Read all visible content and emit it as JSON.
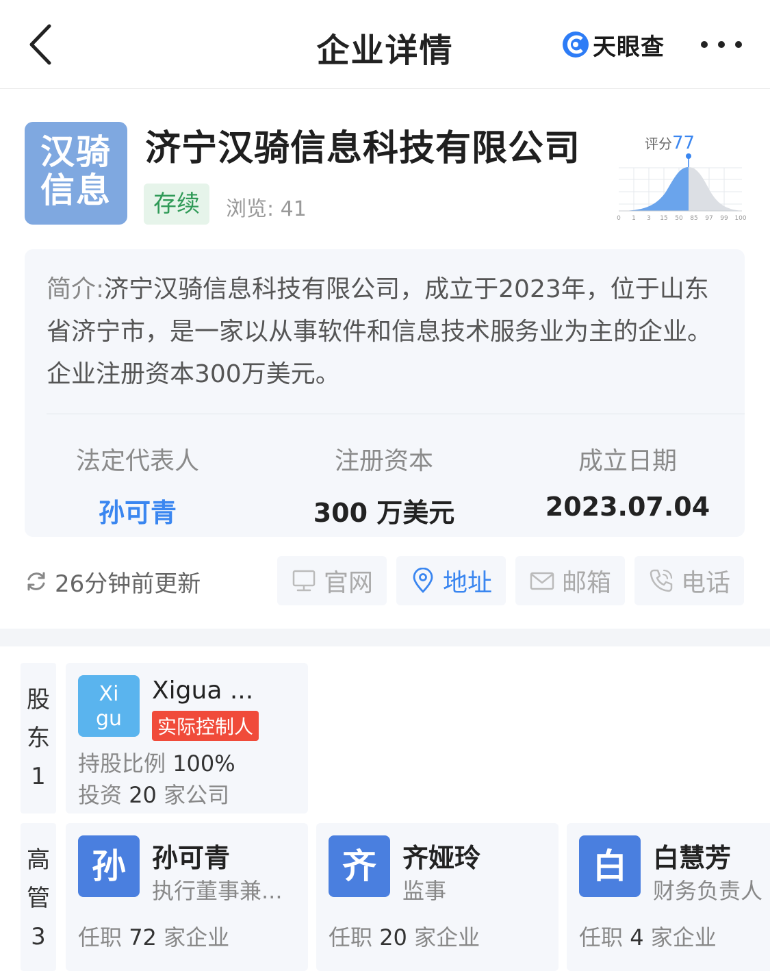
{
  "header": {
    "title": "企业详情",
    "brand": "天眼查"
  },
  "company": {
    "logo_line1": "汉骑",
    "logo_line2": "信息",
    "name": "济宁汉骑信息科技有限公司",
    "status": "存续",
    "views_label": "浏览: 41",
    "score_label": "评分",
    "score_value": "77",
    "score_axis_ticks": [
      "0",
      "1",
      "3",
      "15",
      "50",
      "85",
      "97",
      "99",
      "100"
    ]
  },
  "intro": {
    "key": "简介:",
    "text": "济宁汉骑信息科技有限公司，成立于2023年，位于山东省济宁市，是一家以从事软件和信息技术服务业为主的企业。企业注册资本300万美元。"
  },
  "stats": [
    {
      "label": "法定代表人",
      "value": "孙可青"
    },
    {
      "label": "注册资本",
      "value": "300 万美元"
    },
    {
      "label": "成立日期",
      "value": "2023.07.04"
    }
  ],
  "update_text": "26分钟前更新",
  "actions": [
    {
      "label": "官网",
      "icon": "monitor-icon",
      "active": false
    },
    {
      "label": "地址",
      "icon": "location-pin-icon",
      "active": true
    },
    {
      "label": "邮箱",
      "icon": "mail-icon",
      "active": false
    },
    {
      "label": "电话",
      "icon": "phone-icon",
      "active": false
    }
  ],
  "shareholders": {
    "side_line1": "股",
    "side_line2": "东",
    "side_count": "1",
    "items": [
      {
        "avatar_line1": "Xi",
        "avatar_line2": "gu",
        "name": "Xigua ...",
        "tag": "实际控制人",
        "ratio_label": "持股比例",
        "ratio_value": "100%",
        "invest_prefix": "投资",
        "invest_count": "20",
        "invest_suffix": "家公司"
      }
    ]
  },
  "executives": {
    "side_line1": "高",
    "side_line2": "管",
    "side_count": "3",
    "items": [
      {
        "avatar": "孙",
        "name": "孙可青",
        "role": "执行董事兼...",
        "job_prefix": "任职",
        "job_count": "72",
        "job_suffix": "家企业"
      },
      {
        "avatar": "齐",
        "name": "齐娅玲",
        "role": "监事",
        "job_prefix": "任职",
        "job_count": "20",
        "job_suffix": "家企业"
      },
      {
        "avatar": "白",
        "name": "白慧芳",
        "role": "财务负责人",
        "job_prefix": "任职",
        "job_count": "4",
        "job_suffix": "家企业"
      }
    ]
  }
}
